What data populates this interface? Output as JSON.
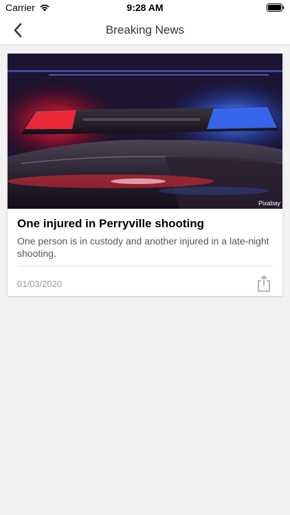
{
  "status_bar": {
    "carrier": "Carrier",
    "time": "9:28 AM",
    "wifi_icon": "wifi-icon",
    "battery_icon": "battery-icon"
  },
  "nav": {
    "title": "Breaking News",
    "back_icon": "chevron-left-icon"
  },
  "article": {
    "image_subject": "police car emergency lights at night",
    "image_credit": "Pixabay",
    "title": "One injured in Perryville shooting",
    "summary": "One person is in custody and another injured in a late-night shooting.",
    "date": "01/03/2020",
    "share_icon": "share-icon"
  },
  "colors": {
    "background": "#f2f2f2",
    "card": "#ffffff",
    "nav_title": "#333333",
    "summary_text": "#555555",
    "date_text": "#9a9a9a",
    "light_red": "#ff2a3a",
    "light_blue": "#3a6bff"
  }
}
